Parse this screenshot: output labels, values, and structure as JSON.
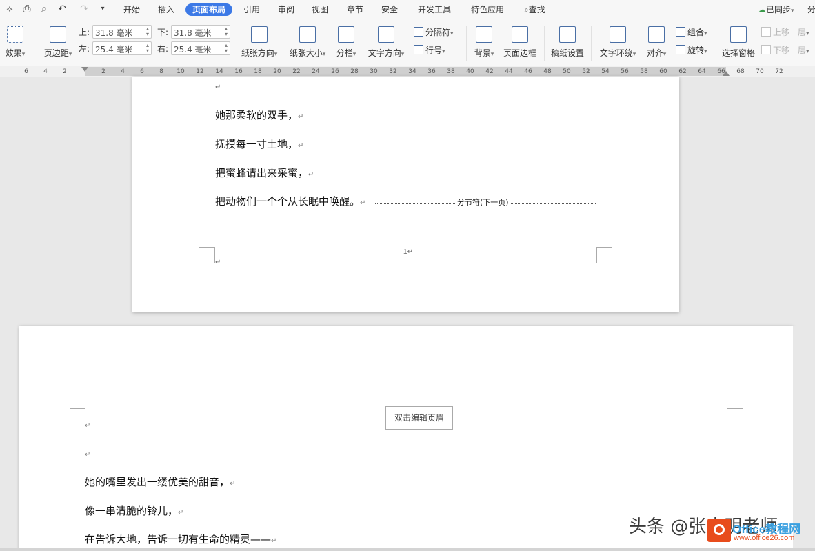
{
  "quick_access": [
    "wps-logo-icon",
    "print-icon",
    "print-preview-icon",
    "undo-icon",
    "redo-icon",
    "more-icon"
  ],
  "menu": {
    "start": "开始",
    "insert": "插入",
    "layout": "页面布局",
    "reference": "引用",
    "review": "审阅",
    "view": "视图",
    "chapter": "章节",
    "security": "安全",
    "developer": "开发工具",
    "features": "特色应用",
    "search": "查找"
  },
  "top_right": {
    "sync": "已同步",
    "share": "分"
  },
  "toolbar": {
    "effects": "效果",
    "margins": "页边距",
    "margin_top_label": "上:",
    "margin_top": "31.8 毫米",
    "margin_bottom_label": "下:",
    "margin_bottom": "31.8 毫米",
    "margin_left_label": "左:",
    "margin_left": "25.4 毫米",
    "margin_right_label": "右:",
    "margin_right": "25.4 毫米",
    "orientation": "纸张方向",
    "size": "纸张大小",
    "columns": "分栏",
    "text_direction": "文字方向",
    "separator": "分隔符",
    "line_numbers": "行号",
    "background": "背景",
    "page_border": "页面边框",
    "manuscript": "稿纸设置",
    "wrap_text": "文字环绕",
    "align": "对齐",
    "group": "组合",
    "rotate": "旋转",
    "selection_pane": "选择窗格",
    "bring_forward": "上移一层",
    "send_backward": "下移一层"
  },
  "ruler": [
    "6",
    "4",
    "2",
    "2",
    "4",
    "6",
    "8",
    "10",
    "12",
    "14",
    "16",
    "18",
    "20",
    "22",
    "24",
    "26",
    "28",
    "30",
    "32",
    "34",
    "36",
    "38",
    "40",
    "42",
    "44",
    "46",
    "48",
    "50",
    "52",
    "54",
    "56",
    "58",
    "60",
    "62",
    "64",
    "66",
    "68",
    "70",
    "72"
  ],
  "page1": {
    "lines": [
      "她那柔软的双手，",
      "抚摸每一寸土地，",
      "把蜜蜂请出来采蜜，",
      "把动物们一个个从长眠中唤醒。"
    ],
    "section_break": "分节符(下一页)",
    "page_number": "1"
  },
  "page2": {
    "header_button": "双击编辑页眉",
    "lines": [
      "她的嘴里发出一缕优美的甜音，",
      "像一串清脆的铃儿，",
      "在告诉大地，告诉一切有生命的精灵——"
    ]
  },
  "paragraph_mark": "↵",
  "watermark": {
    "text": "头条 @张水明老师",
    "logo_main": "Office教程网",
    "logo_sub": "www.office26.com"
  },
  "colors": {
    "accent": "#3c79e6",
    "page": "#ffffff",
    "canvas": "#e8e8e8"
  }
}
